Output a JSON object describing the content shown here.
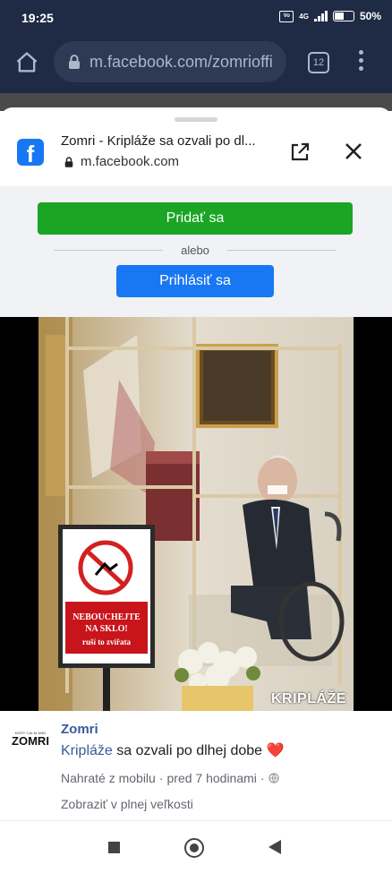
{
  "status_bar": {
    "time": "19:25",
    "network": "4G",
    "battery": "50%"
  },
  "browser": {
    "url": "m.facebook.com/zomrioffi",
    "tabs_count": "12"
  },
  "sheet": {
    "title": "Zomri - Kripláže sa ozvali po dl...",
    "url": "m.facebook.com",
    "join_label": "Pridať sa",
    "or_label": "alebo",
    "login_label": "Prihlásiť sa"
  },
  "video": {
    "sign_line1": "NEBOUCHEJTE",
    "sign_line2": "NA SKLO!",
    "sign_line3": "ruší to zvířata",
    "watermark": "KRIPLÁŽE"
  },
  "post": {
    "avatar_top": "KEEP CALM AND",
    "avatar_name": "ZOMRI",
    "page_name": "Zomri",
    "hashtag": "Kripláže",
    "text": " sa ozvali po dlhej dobe ❤️",
    "uploaded": "Nahraté z mobilu",
    "time": "pred 7 hodinami",
    "view_full": "Zobraziť v plnej veľkosti"
  },
  "colors": {
    "browser_bar": "#1f2b44",
    "join_green": "#1aa525",
    "login_blue": "#1877f2",
    "link_blue": "#3b5998"
  },
  "icons": [
    "home-icon",
    "lock-icon",
    "tabs-icon",
    "menu-dots-icon",
    "facebook-icon",
    "open-external-icon",
    "close-icon",
    "globe-icon",
    "nav-recents-icon",
    "nav-home-icon",
    "nav-back-icon"
  ]
}
